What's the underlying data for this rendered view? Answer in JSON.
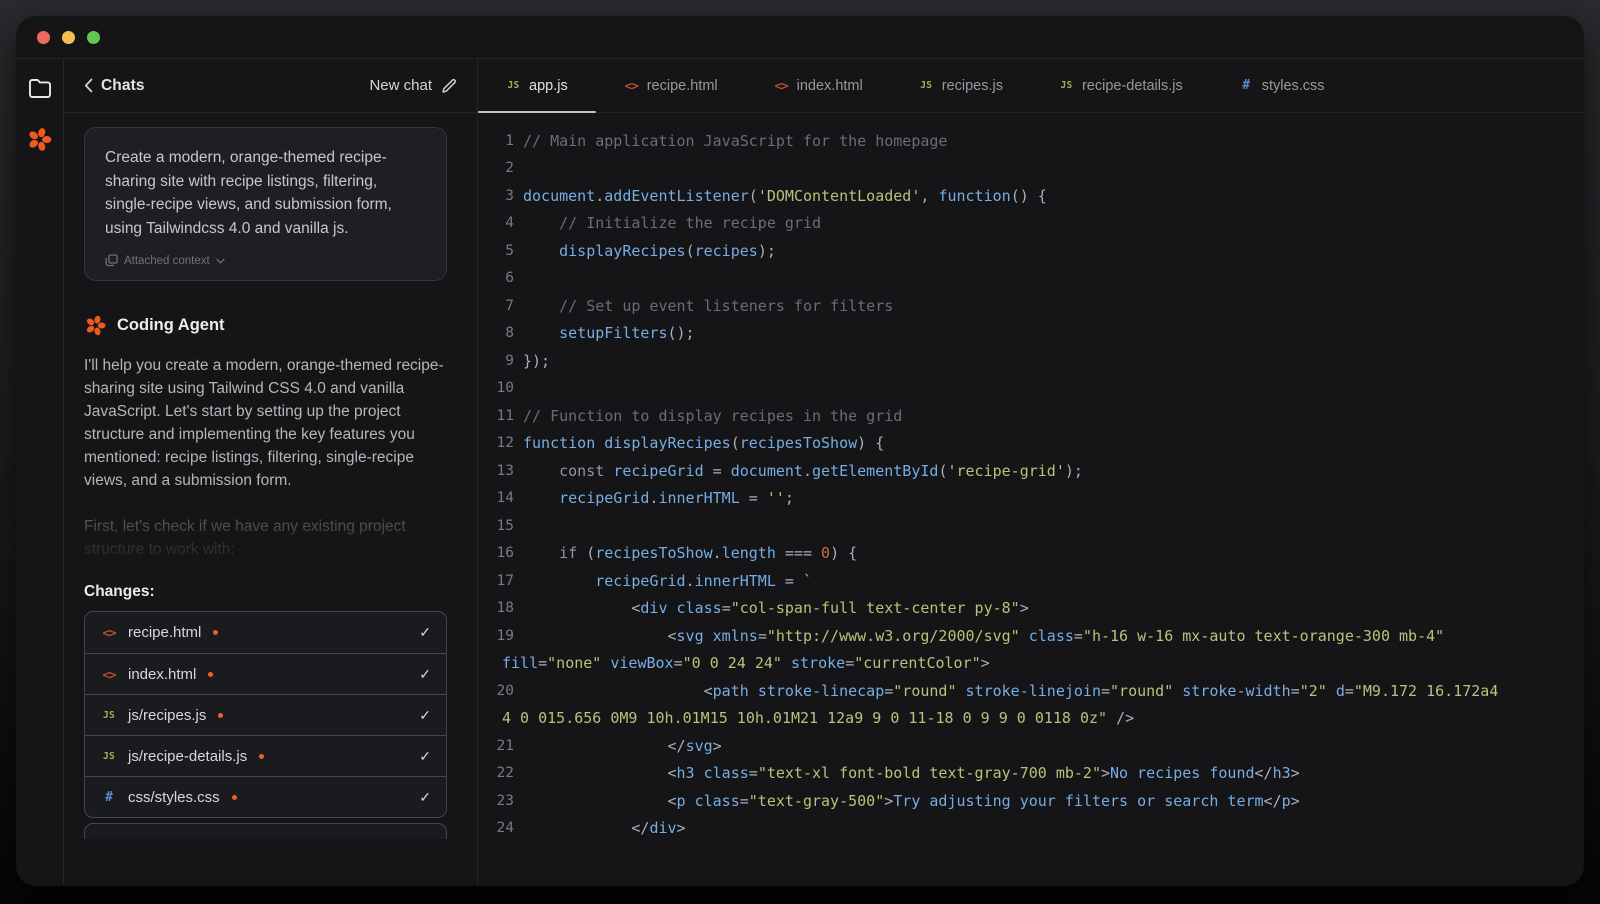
{
  "colors": {
    "accent_orange": "#ee5a1d",
    "traffic": [
      "#ed6a5f",
      "#f5bf4f",
      "#62c554"
    ],
    "icon_js": "#9fb454",
    "icon_html": "#b4532e",
    "icon_css": "#5b8bd0",
    "modified_dot": "#e8602c",
    "active_tab_underline": "#c2c3c5"
  },
  "icons": {
    "js": "JS",
    "html": "<>",
    "css": "#",
    "check": "✓"
  },
  "chat": {
    "header": {
      "back": "‹",
      "title": "Chats",
      "new_chat": "New chat"
    },
    "user_message": {
      "text": "Create a modern, orange-themed recipe-sharing site with recipe listings, filtering, single-recipe views, and submission form, using Tailwindcss 4.0 and vanilla js.",
      "attachment": "Attached context"
    },
    "agent": {
      "name": "Coding Agent",
      "message": "I'll help you create a modern, orange-themed recipe-sharing site using Tailwind CSS 4.0 and vanilla JavaScript. Let's start by setting up the project structure and implementing the key features you mentioned: recipe listings, filtering, single-recipe views, and a submission form.",
      "pending": "First, let's check if we have any existing project structure to work with:"
    },
    "changes": {
      "heading": "Changes:",
      "files": [
        {
          "name": "recipe.html",
          "type": "html"
        },
        {
          "name": "index.html",
          "type": "html"
        },
        {
          "name": "js/recipes.js",
          "type": "js"
        },
        {
          "name": "js/recipe-details.js",
          "type": "js"
        },
        {
          "name": "css/styles.css",
          "type": "css"
        }
      ]
    }
  },
  "editor": {
    "tabs": [
      {
        "label": "app.js",
        "type": "js",
        "active": true
      },
      {
        "label": "recipe.html",
        "type": "html",
        "active": false
      },
      {
        "label": "index.html",
        "type": "html",
        "active": false
      },
      {
        "label": "recipes.js",
        "type": "js",
        "active": false
      },
      {
        "label": "recipe-details.js",
        "type": "js",
        "active": false
      },
      {
        "label": "styles.css",
        "type": "css",
        "active": false
      }
    ],
    "code_rows": [
      {
        "n": "1",
        "seg": [
          [
            "c",
            "// Main application JavaScript for the homepage"
          ]
        ]
      },
      {
        "n": "2",
        "seg": []
      },
      {
        "n": "3",
        "seg": [
          [
            "b",
            "document"
          ],
          [
            "g",
            "."
          ],
          [
            "b",
            "addEventListener"
          ],
          [
            "g",
            "("
          ],
          [
            "s",
            "'DOMContentLoaded'"
          ],
          [
            "g",
            ", "
          ],
          [
            "b",
            "function"
          ],
          [
            "g",
            "() {"
          ]
        ]
      },
      {
        "n": "4",
        "seg": [
          [
            "c",
            "    // Initialize the recipe grid"
          ]
        ]
      },
      {
        "n": "5",
        "seg": [
          [
            "g",
            "    "
          ],
          [
            "b",
            "displayRecipes"
          ],
          [
            "g",
            "("
          ],
          [
            "b",
            "recipes"
          ],
          [
            "g",
            ");"
          ]
        ]
      },
      {
        "n": "6",
        "seg": []
      },
      {
        "n": "7",
        "seg": [
          [
            "c",
            "    // Set up event listeners for filters"
          ]
        ]
      },
      {
        "n": "8",
        "seg": [
          [
            "g",
            "    "
          ],
          [
            "b",
            "setupFilters"
          ],
          [
            "g",
            "();"
          ]
        ]
      },
      {
        "n": "9",
        "seg": [
          [
            "g",
            "});"
          ]
        ]
      },
      {
        "n": "10",
        "seg": []
      },
      {
        "n": "11",
        "seg": [
          [
            "c",
            "// Function to display recipes in the grid"
          ]
        ]
      },
      {
        "n": "12",
        "seg": [
          [
            "b",
            "function "
          ],
          [
            "b",
            "displayRecipes"
          ],
          [
            "g",
            "("
          ],
          [
            "b",
            "recipesToShow"
          ],
          [
            "g",
            ") {"
          ]
        ]
      },
      {
        "n": "13",
        "seg": [
          [
            "g",
            "    "
          ],
          [
            "k",
            "const"
          ],
          [
            "g",
            " "
          ],
          [
            "b",
            "recipeGrid"
          ],
          [
            "g",
            " = "
          ],
          [
            "b",
            "document"
          ],
          [
            "g",
            "."
          ],
          [
            "b",
            "getElementById"
          ],
          [
            "g",
            "("
          ],
          [
            "s",
            "'recipe-grid'"
          ],
          [
            "g",
            ");"
          ]
        ]
      },
      {
        "n": "14",
        "seg": [
          [
            "g",
            "    "
          ],
          [
            "b",
            "recipeGrid"
          ],
          [
            "g",
            "."
          ],
          [
            "b",
            "innerHTML"
          ],
          [
            "g",
            " = "
          ],
          [
            "s",
            "''"
          ],
          [
            "g",
            ";"
          ]
        ]
      },
      {
        "n": "15",
        "seg": []
      },
      {
        "n": "16",
        "seg": [
          [
            "g",
            "    "
          ],
          [
            "k",
            "if"
          ],
          [
            "g",
            " ("
          ],
          [
            "b",
            "recipesToShow"
          ],
          [
            "g",
            "."
          ],
          [
            "b",
            "length"
          ],
          [
            "g",
            " === "
          ],
          [
            "n",
            "0"
          ],
          [
            "g",
            ") {"
          ]
        ]
      },
      {
        "n": "17",
        "seg": [
          [
            "g",
            "        "
          ],
          [
            "b",
            "recipeGrid"
          ],
          [
            "g",
            "."
          ],
          [
            "b",
            "innerHTML"
          ],
          [
            "g",
            " = "
          ],
          [
            "s",
            "`"
          ]
        ]
      },
      {
        "n": "18",
        "seg": [
          [
            "g",
            "            <"
          ],
          [
            "b",
            "div"
          ],
          [
            "g",
            " "
          ],
          [
            "b",
            "class"
          ],
          [
            "g",
            "="
          ],
          [
            "s",
            "\"col-span-full text-center py-8\""
          ],
          [
            "g",
            ">"
          ]
        ]
      },
      {
        "n": "19",
        "seg": [
          [
            "g",
            "                <"
          ],
          [
            "b",
            "svg"
          ],
          [
            "g",
            " "
          ],
          [
            "b",
            "xmlns"
          ],
          [
            "g",
            "="
          ],
          [
            "s",
            "\"http://www.w3.org/2000/svg\""
          ],
          [
            "g",
            " "
          ],
          [
            "b",
            "class"
          ],
          [
            "g",
            "="
          ],
          [
            "s",
            "\"h-16 w-16 mx-auto text-orange-300 mb-4\""
          ]
        ]
      },
      {
        "n": "",
        "cont": true,
        "seg": [
          [
            "b",
            "fill"
          ],
          [
            "g",
            "="
          ],
          [
            "s",
            "\"none\""
          ],
          [
            "g",
            " "
          ],
          [
            "b",
            "viewBox"
          ],
          [
            "g",
            "="
          ],
          [
            "s",
            "\"0 0 24 24\""
          ],
          [
            "g",
            " "
          ],
          [
            "b",
            "stroke"
          ],
          [
            "g",
            "="
          ],
          [
            "s",
            "\"currentColor\""
          ],
          [
            "g",
            ">"
          ]
        ]
      },
      {
        "n": "20",
        "seg": [
          [
            "g",
            "                    <"
          ],
          [
            "b",
            "path"
          ],
          [
            "g",
            " "
          ],
          [
            "b",
            "stroke-linecap"
          ],
          [
            "g",
            "="
          ],
          [
            "s",
            "\"round\""
          ],
          [
            "g",
            " "
          ],
          [
            "b",
            "stroke-linejoin"
          ],
          [
            "g",
            "="
          ],
          [
            "s",
            "\"round\""
          ],
          [
            "g",
            " "
          ],
          [
            "b",
            "stroke-width"
          ],
          [
            "g",
            "="
          ],
          [
            "s",
            "\"2\""
          ],
          [
            "g",
            " "
          ],
          [
            "b",
            "d"
          ],
          [
            "g",
            "="
          ],
          [
            "s",
            "\"M9.172 16.172a4"
          ]
        ]
      },
      {
        "n": "",
        "cont": true,
        "seg": [
          [
            "s",
            "4 0 015.656 0M9 10h.01M15 10h.01M21 12a9 9 0 11-18 0 9 9 0 0118 0z\""
          ],
          [
            "g",
            " />"
          ]
        ]
      },
      {
        "n": "21",
        "seg": [
          [
            "g",
            "                </"
          ],
          [
            "b",
            "svg"
          ],
          [
            "g",
            ">"
          ]
        ]
      },
      {
        "n": "22",
        "seg": [
          [
            "g",
            "                <"
          ],
          [
            "b",
            "h3"
          ],
          [
            "g",
            " "
          ],
          [
            "b",
            "class"
          ],
          [
            "g",
            "="
          ],
          [
            "s",
            "\"text-xl font-bold text-gray-700 mb-2\""
          ],
          [
            "g",
            ">"
          ],
          [
            "b",
            "No recipes found"
          ],
          [
            "g",
            "</"
          ],
          [
            "b",
            "h3"
          ],
          [
            "g",
            ">"
          ]
        ]
      },
      {
        "n": "23",
        "seg": [
          [
            "g",
            "                <"
          ],
          [
            "b",
            "p"
          ],
          [
            "g",
            " "
          ],
          [
            "b",
            "class"
          ],
          [
            "g",
            "="
          ],
          [
            "s",
            "\"text-gray-500\""
          ],
          [
            "g",
            ">"
          ],
          [
            "b",
            "Try adjusting your filters or search term"
          ],
          [
            "g",
            "</"
          ],
          [
            "b",
            "p"
          ],
          [
            "g",
            ">"
          ]
        ]
      },
      {
        "n": "24",
        "seg": [
          [
            "g",
            "            </"
          ],
          [
            "b",
            "div"
          ],
          [
            "g",
            ">"
          ]
        ]
      }
    ]
  }
}
